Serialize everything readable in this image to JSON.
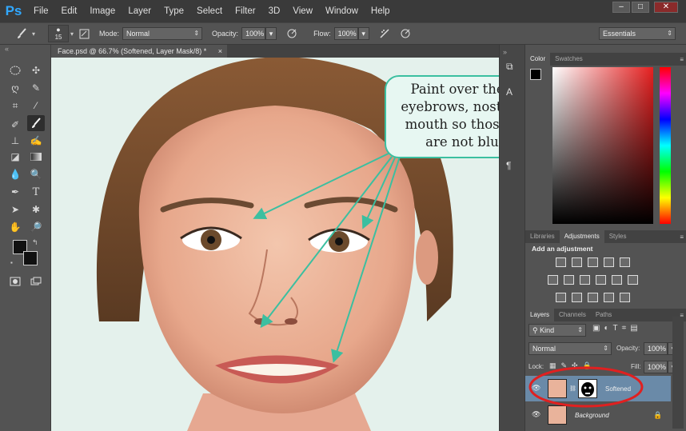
{
  "app": {
    "logo": "Ps"
  },
  "menu": [
    "File",
    "Edit",
    "Image",
    "Layer",
    "Type",
    "Select",
    "Filter",
    "3D",
    "View",
    "Window",
    "Help"
  ],
  "window_controls": [
    "–",
    "□",
    "✕"
  ],
  "options_bar": {
    "brush_size": "15",
    "mode_label": "Mode:",
    "mode_value": "Normal",
    "opacity_label": "Opacity:",
    "opacity_value": "100%",
    "flow_label": "Flow:",
    "flow_value": "100%",
    "workspace": "Essentials"
  },
  "document_tab": {
    "title": "Face.psd @ 66.7% (Softened, Layer Mask/8) *",
    "close": "×"
  },
  "color_panel": {
    "tabs": [
      "Color",
      "Swatches"
    ],
    "active_tab": "Color"
  },
  "adjustments_panel": {
    "tabs": [
      "Libraries",
      "Adjustments",
      "Styles"
    ],
    "active_tab": "Adjustments",
    "heading": "Add an adjustment"
  },
  "layers_panel": {
    "tabs": [
      "Layers",
      "Channels",
      "Paths"
    ],
    "active_tab": "Layers",
    "filter_kind": "Kind",
    "blend_mode": "Normal",
    "opacity_label": "Opacity:",
    "opacity_value": "100%",
    "lock_label": "Lock:",
    "fill_label": "Fill:",
    "fill_value": "100%",
    "layers": [
      {
        "name": "Softened",
        "selected": true
      },
      {
        "name": "Background",
        "selected": false
      }
    ]
  },
  "callout": {
    "lines": [
      "Paint over the eyes,",
      "eyebrows, nostrils and",
      "mouth so those areas",
      "are not blurred"
    ]
  },
  "colors": {
    "accent": "#3bbfa0",
    "highlight_ellipse": "#e02020"
  }
}
